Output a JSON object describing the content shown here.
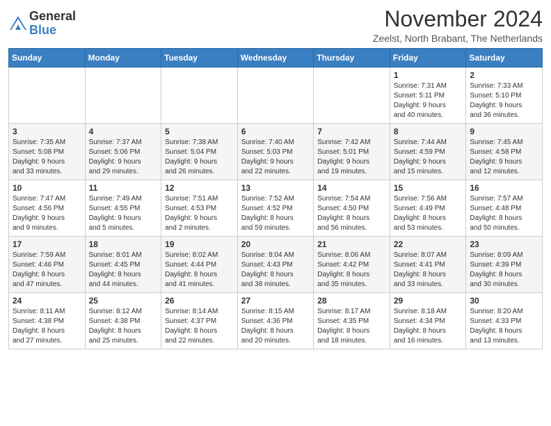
{
  "logo": {
    "general": "General",
    "blue": "Blue"
  },
  "title": "November 2024",
  "location": "Zeelst, North Brabant, The Netherlands",
  "weekdays": [
    "Sunday",
    "Monday",
    "Tuesday",
    "Wednesday",
    "Thursday",
    "Friday",
    "Saturday"
  ],
  "weeks": [
    [
      {
        "day": "",
        "info": ""
      },
      {
        "day": "",
        "info": ""
      },
      {
        "day": "",
        "info": ""
      },
      {
        "day": "",
        "info": ""
      },
      {
        "day": "",
        "info": ""
      },
      {
        "day": "1",
        "info": "Sunrise: 7:31 AM\nSunset: 5:11 PM\nDaylight: 9 hours\nand 40 minutes."
      },
      {
        "day": "2",
        "info": "Sunrise: 7:33 AM\nSunset: 5:10 PM\nDaylight: 9 hours\nand 36 minutes."
      }
    ],
    [
      {
        "day": "3",
        "info": "Sunrise: 7:35 AM\nSunset: 5:08 PM\nDaylight: 9 hours\nand 33 minutes."
      },
      {
        "day": "4",
        "info": "Sunrise: 7:37 AM\nSunset: 5:06 PM\nDaylight: 9 hours\nand 29 minutes."
      },
      {
        "day": "5",
        "info": "Sunrise: 7:38 AM\nSunset: 5:04 PM\nDaylight: 9 hours\nand 26 minutes."
      },
      {
        "day": "6",
        "info": "Sunrise: 7:40 AM\nSunset: 5:03 PM\nDaylight: 9 hours\nand 22 minutes."
      },
      {
        "day": "7",
        "info": "Sunrise: 7:42 AM\nSunset: 5:01 PM\nDaylight: 9 hours\nand 19 minutes."
      },
      {
        "day": "8",
        "info": "Sunrise: 7:44 AM\nSunset: 4:59 PM\nDaylight: 9 hours\nand 15 minutes."
      },
      {
        "day": "9",
        "info": "Sunrise: 7:45 AM\nSunset: 4:58 PM\nDaylight: 9 hours\nand 12 minutes."
      }
    ],
    [
      {
        "day": "10",
        "info": "Sunrise: 7:47 AM\nSunset: 4:56 PM\nDaylight: 9 hours\nand 9 minutes."
      },
      {
        "day": "11",
        "info": "Sunrise: 7:49 AM\nSunset: 4:55 PM\nDaylight: 9 hours\nand 5 minutes."
      },
      {
        "day": "12",
        "info": "Sunrise: 7:51 AM\nSunset: 4:53 PM\nDaylight: 9 hours\nand 2 minutes."
      },
      {
        "day": "13",
        "info": "Sunrise: 7:52 AM\nSunset: 4:52 PM\nDaylight: 8 hours\nand 59 minutes."
      },
      {
        "day": "14",
        "info": "Sunrise: 7:54 AM\nSunset: 4:50 PM\nDaylight: 8 hours\nand 56 minutes."
      },
      {
        "day": "15",
        "info": "Sunrise: 7:56 AM\nSunset: 4:49 PM\nDaylight: 8 hours\nand 53 minutes."
      },
      {
        "day": "16",
        "info": "Sunrise: 7:57 AM\nSunset: 4:48 PM\nDaylight: 8 hours\nand 50 minutes."
      }
    ],
    [
      {
        "day": "17",
        "info": "Sunrise: 7:59 AM\nSunset: 4:46 PM\nDaylight: 8 hours\nand 47 minutes."
      },
      {
        "day": "18",
        "info": "Sunrise: 8:01 AM\nSunset: 4:45 PM\nDaylight: 8 hours\nand 44 minutes."
      },
      {
        "day": "19",
        "info": "Sunrise: 8:02 AM\nSunset: 4:44 PM\nDaylight: 8 hours\nand 41 minutes."
      },
      {
        "day": "20",
        "info": "Sunrise: 8:04 AM\nSunset: 4:43 PM\nDaylight: 8 hours\nand 38 minutes."
      },
      {
        "day": "21",
        "info": "Sunrise: 8:06 AM\nSunset: 4:42 PM\nDaylight: 8 hours\nand 35 minutes."
      },
      {
        "day": "22",
        "info": "Sunrise: 8:07 AM\nSunset: 4:41 PM\nDaylight: 8 hours\nand 33 minutes."
      },
      {
        "day": "23",
        "info": "Sunrise: 8:09 AM\nSunset: 4:39 PM\nDaylight: 8 hours\nand 30 minutes."
      }
    ],
    [
      {
        "day": "24",
        "info": "Sunrise: 8:11 AM\nSunset: 4:38 PM\nDaylight: 8 hours\nand 27 minutes."
      },
      {
        "day": "25",
        "info": "Sunrise: 8:12 AM\nSunset: 4:38 PM\nDaylight: 8 hours\nand 25 minutes."
      },
      {
        "day": "26",
        "info": "Sunrise: 8:14 AM\nSunset: 4:37 PM\nDaylight: 8 hours\nand 22 minutes."
      },
      {
        "day": "27",
        "info": "Sunrise: 8:15 AM\nSunset: 4:36 PM\nDaylight: 8 hours\nand 20 minutes."
      },
      {
        "day": "28",
        "info": "Sunrise: 8:17 AM\nSunset: 4:35 PM\nDaylight: 8 hours\nand 18 minutes."
      },
      {
        "day": "29",
        "info": "Sunrise: 8:18 AM\nSunset: 4:34 PM\nDaylight: 8 hours\nand 16 minutes."
      },
      {
        "day": "30",
        "info": "Sunrise: 8:20 AM\nSunset: 4:33 PM\nDaylight: 8 hours\nand 13 minutes."
      }
    ]
  ]
}
